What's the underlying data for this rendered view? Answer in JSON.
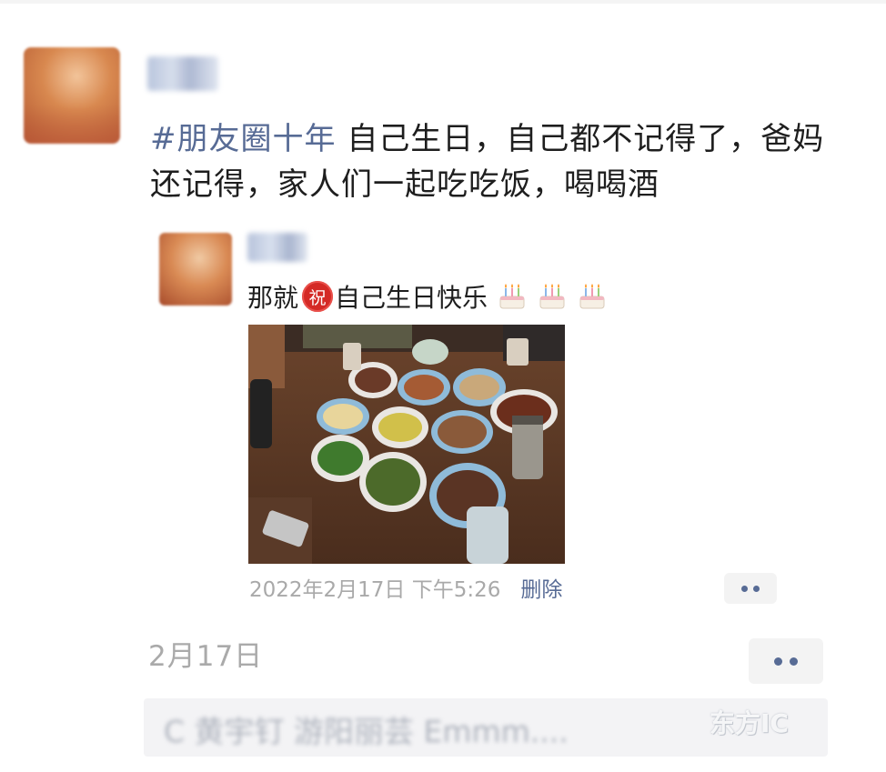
{
  "post": {
    "author": "周泽",
    "tag": "#朋友圈十年",
    "text": "自己生日，自己都不记得了，爸妈还记得，家人们一起吃吃饭，喝喝酒"
  },
  "quoted": {
    "author": "周泽",
    "text_before": "那就",
    "zhu_char": "祝",
    "text_after": "自己生日快乐",
    "emojis": [
      "birthday-cake-icon",
      "birthday-cake-icon",
      "birthday-cake-icon"
    ],
    "timestamp": "2022年2月17日 下午5:26",
    "delete_label": "删除"
  },
  "post_date": "2月17日",
  "comment": {
    "text": "C 黄宇钉 游阳丽芸 Emmm....",
    "watermark": "东方IC"
  },
  "colors": {
    "link": "#576b95",
    "meta_text": "#a9a9a9",
    "zhu_red": "#d42a26"
  }
}
